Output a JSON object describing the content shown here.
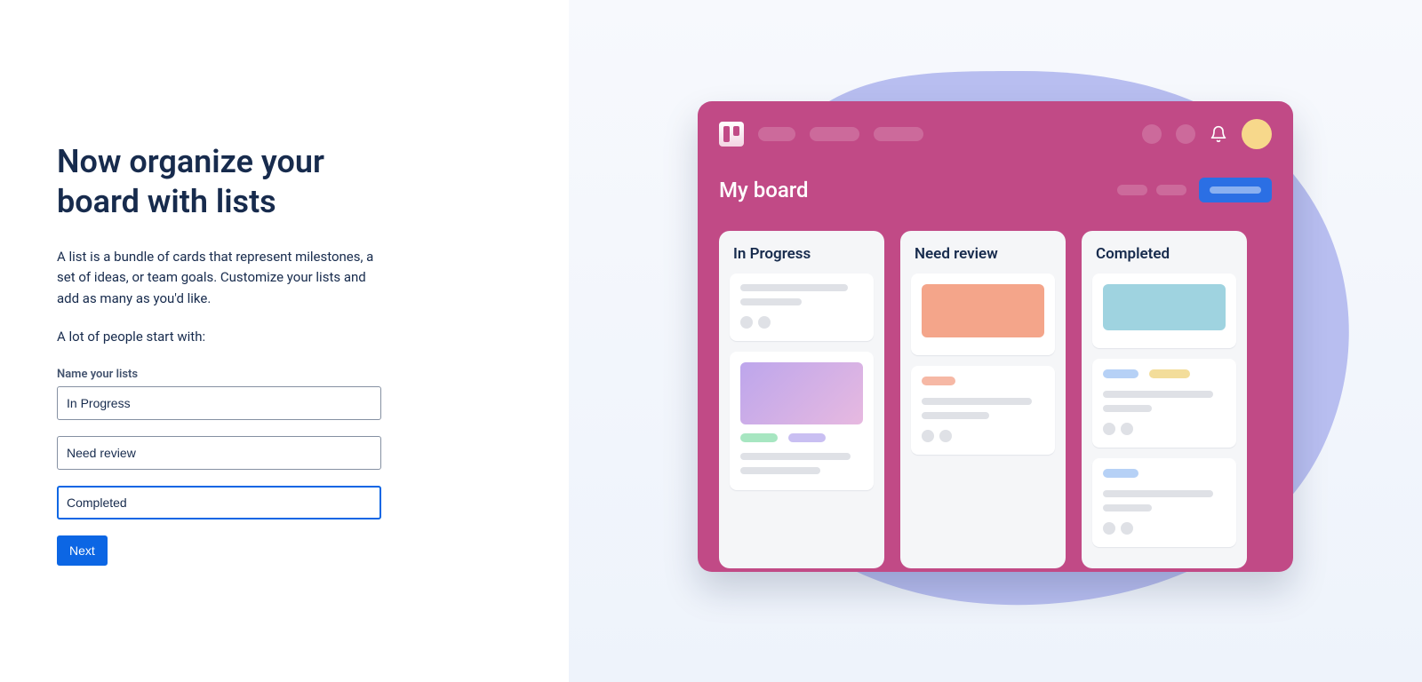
{
  "page": {
    "title": "Now organize your board with lists",
    "description": "A list is a bundle of cards that represent milestones, a set of ideas, or team goals. Customize your lists and add as many as you'd like.",
    "sub_description": "A lot of people start with:"
  },
  "form": {
    "label": "Name your lists",
    "inputs": {
      "list1": "In Progress",
      "list2": "Need review",
      "list3": "Completed"
    },
    "next_label": "Next"
  },
  "preview": {
    "board_title": "My board",
    "lists": [
      "In Progress",
      "Need review",
      "Completed"
    ]
  },
  "colors": {
    "board_bg": "#c14a86",
    "primary": "#0c66e4",
    "avatar": "#f7d88b",
    "blob": "#b8bef0"
  }
}
